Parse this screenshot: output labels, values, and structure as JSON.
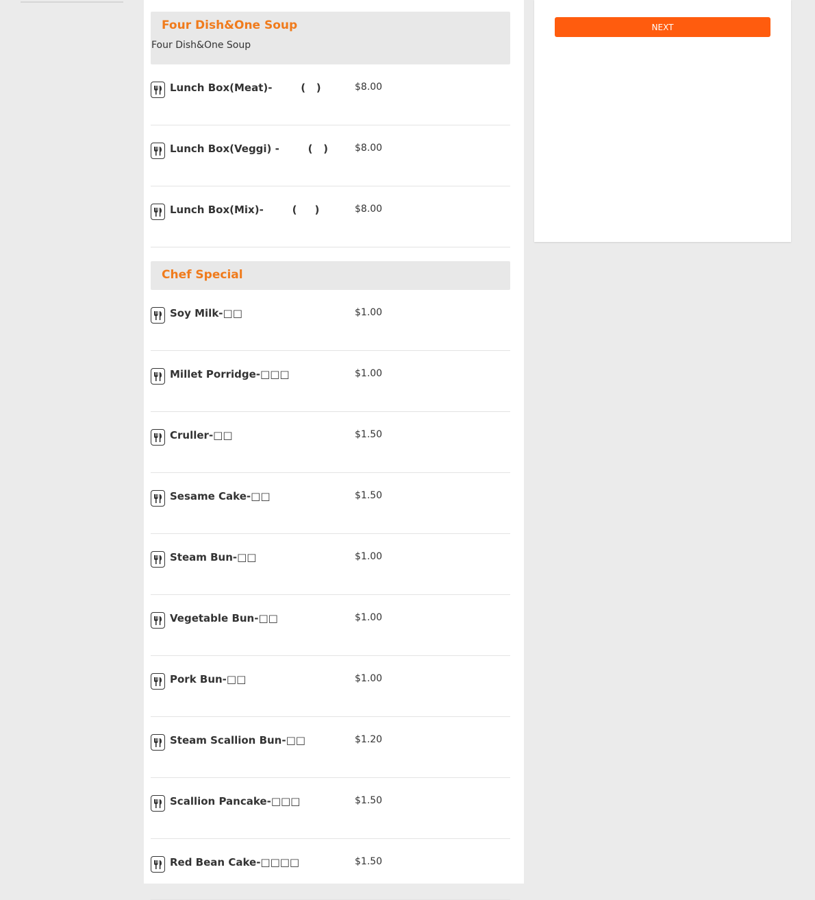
{
  "colors": {
    "accent": "#f07b1c",
    "button": "#ff5c0e",
    "background": "#ebebeb",
    "header_bg": "#e8e8e8"
  },
  "categories": [
    {
      "title": "Four Dish&One Soup",
      "description": "Four Dish&One Soup",
      "items": [
        {
          "name": "Lunch Box(Meat)-        (   )",
          "price": "$8.00",
          "icon": "utensils-icon"
        },
        {
          "name": "Lunch Box(Veggi) -        (   )",
          "price": "$8.00",
          "icon": "utensils-icon"
        },
        {
          "name": "Lunch Box(Mix)-        (     )",
          "price": "$8.00",
          "icon": "utensils-icon"
        }
      ]
    },
    {
      "title": "Chef Special",
      "description": "",
      "items": [
        {
          "name": "Soy Milk-□□",
          "price": "$1.00",
          "icon": "utensils-icon"
        },
        {
          "name": "Millet Porridge-□□□",
          "price": "$1.00",
          "icon": "utensils-icon"
        },
        {
          "name": "Cruller-□□",
          "price": "$1.50",
          "icon": "utensils-icon"
        },
        {
          "name": "Sesame Cake-□□",
          "price": "$1.50",
          "icon": "utensils-icon"
        },
        {
          "name": "Steam Bun-□□",
          "price": "$1.00",
          "icon": "utensils-icon"
        },
        {
          "name": "Vegetable Bun-□□",
          "price": "$1.00",
          "icon": "utensils-icon"
        },
        {
          "name": "Pork Bun-□□",
          "price": "$1.00",
          "icon": "utensils-icon"
        },
        {
          "name": "Steam Scallion Bun-□□",
          "price": "$1.20",
          "icon": "utensils-icon"
        },
        {
          "name": "Scallion Pancake-□□□",
          "price": "$1.50",
          "icon": "utensils-icon"
        },
        {
          "name": "Red Bean Cake-□□□□",
          "price": "$1.50",
          "icon": "utensils-icon"
        }
      ]
    }
  ],
  "side_panel": {
    "next_label": "NEXT"
  }
}
